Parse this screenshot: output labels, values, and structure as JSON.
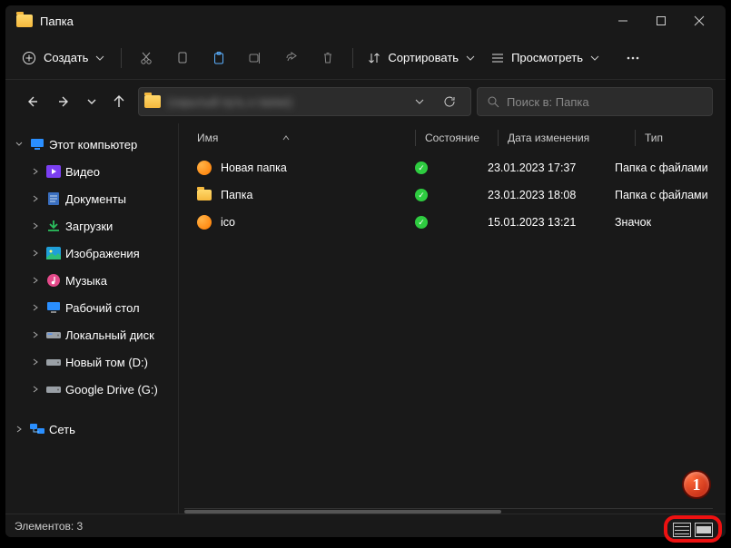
{
  "window": {
    "title": "Папка"
  },
  "toolbar": {
    "new_label": "Создать",
    "sort_label": "Сортировать",
    "view_label": "Просмотреть"
  },
  "address": {
    "path": "(скрытый путь к папке)",
    "search_placeholder": "Поиск в: Папка"
  },
  "sidebar": {
    "this_pc": "Этот компьютер",
    "items": [
      {
        "label": "Видео"
      },
      {
        "label": "Документы"
      },
      {
        "label": "Загрузки"
      },
      {
        "label": "Изображения"
      },
      {
        "label": "Музыка"
      },
      {
        "label": "Рабочий стол"
      },
      {
        "label": "Локальный диск"
      },
      {
        "label": "Новый том (D:)"
      },
      {
        "label": "Google Drive (G:)"
      }
    ],
    "network": "Сеть"
  },
  "columns": {
    "name": "Имя",
    "state": "Состояние",
    "date": "Дата изменения",
    "type": "Тип"
  },
  "rows": [
    {
      "name": "Новая папка",
      "date": "23.01.2023 17:37",
      "type": "Папка с файлами"
    },
    {
      "name": "Папка",
      "date": "23.01.2023 18:08",
      "type": "Папка с файлами"
    },
    {
      "name": "ico",
      "date": "15.01.2023 13:21",
      "type": "Значок"
    }
  ],
  "status": {
    "items_label": "Элементов:",
    "items_count": "3"
  },
  "annotation": {
    "badge": "1"
  }
}
